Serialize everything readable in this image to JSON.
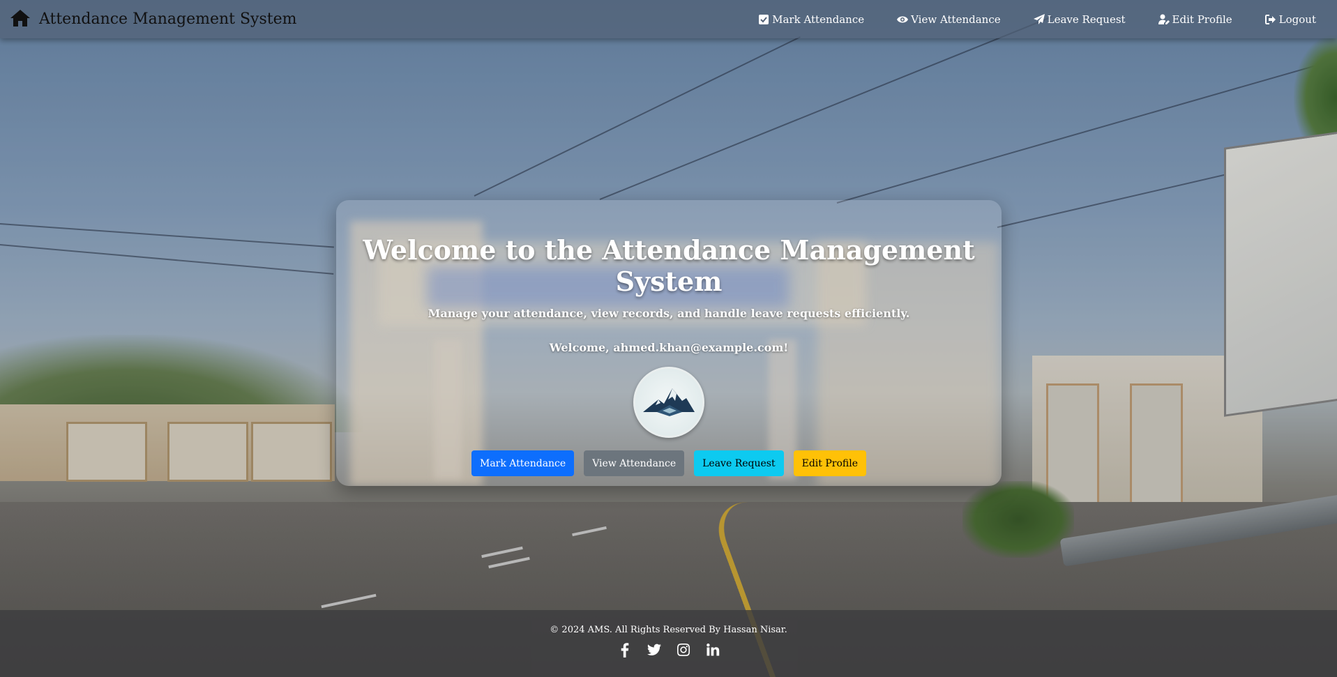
{
  "navbar": {
    "brand_icon": "home-icon",
    "title": "Attendance Management System",
    "links": [
      {
        "label": "Mark Attendance",
        "icon": "check-square-icon"
      },
      {
        "label": "View Attendance",
        "icon": "eye-icon"
      },
      {
        "label": "Leave Request",
        "icon": "paper-plane-icon"
      },
      {
        "label": "Edit Profile",
        "icon": "user-edit-icon"
      },
      {
        "label": "Logout",
        "icon": "sign-out-icon"
      }
    ]
  },
  "card": {
    "title": "Welcome to the Attendance Management System",
    "subtitle": "Manage your attendance, view records, and handle leave requests efficiently.",
    "welcome": "Welcome, ahmed.khan@example.com!",
    "logo_icon": "mountain-logo-icon",
    "buttons": [
      {
        "label": "Mark Attendance",
        "color": "#0d6efd"
      },
      {
        "label": "View Attendance",
        "color": "#6c757d"
      },
      {
        "label": "Leave Request",
        "color": "#0dcaf0"
      },
      {
        "label": "Edit Profile",
        "color": "#ffc107"
      }
    ]
  },
  "footer": {
    "copyright": "© 2024 AMS. All Rights Reserved By Hassan Nisar.",
    "socials": [
      "facebook-icon",
      "twitter-icon",
      "instagram-icon",
      "linkedin-icon"
    ]
  }
}
